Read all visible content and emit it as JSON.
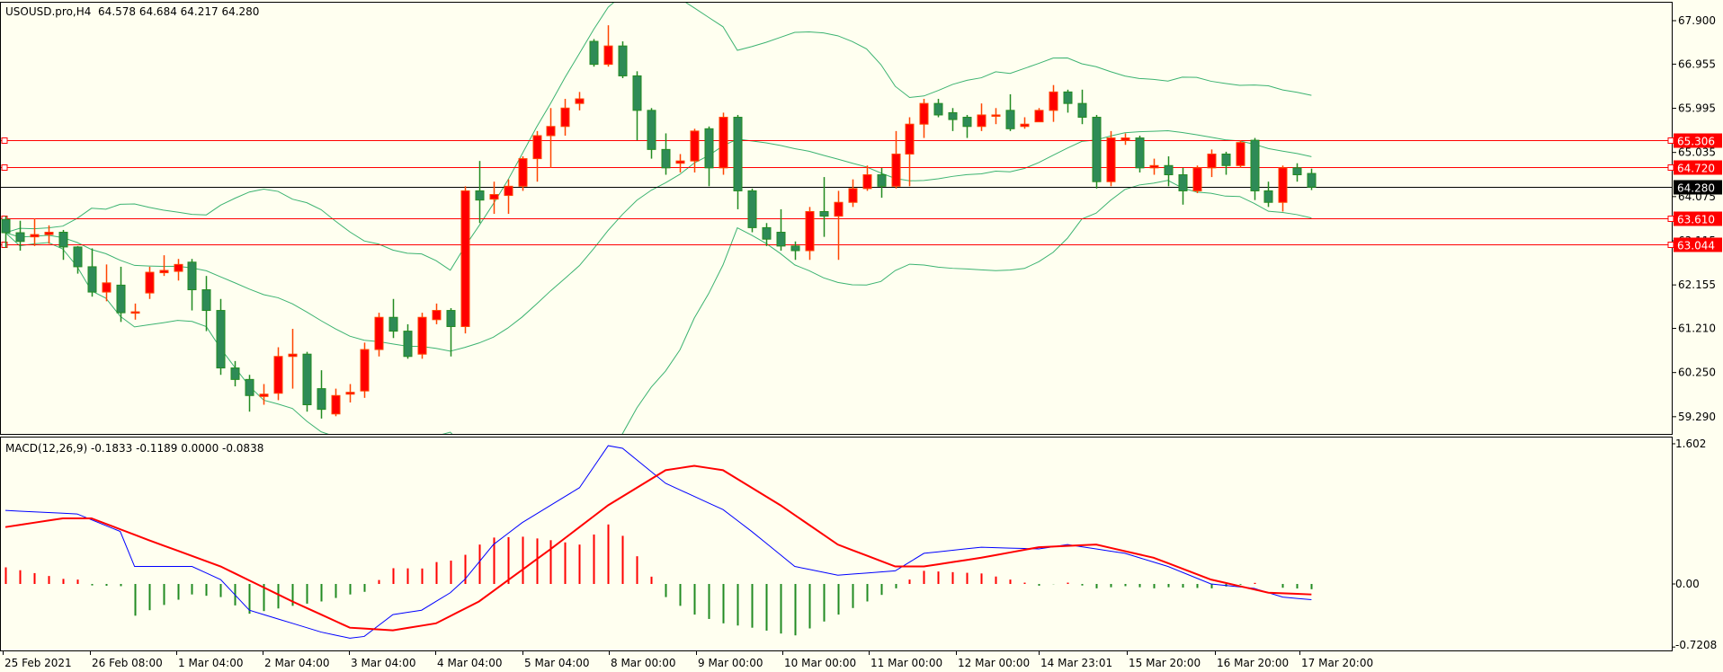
{
  "header": {
    "symbol": "USOUSD.pro,H4",
    "ohlc": "64.578 64.684 64.217 64.280"
  },
  "macd_header": "MACD(12,26,9) -0.1833 -0.1189 0.0000 -0.0838",
  "colors": {
    "background": "#fffff0",
    "bull": "#ff0000",
    "bull_outline": "#ff4500",
    "bear": "#2e8b57",
    "bear_outline": "#228b22",
    "bands": "#3cb371",
    "macd_main": "#0000ff",
    "macd_signal": "#ff0000",
    "hline": "#ff0000"
  },
  "chart_data": {
    "type": "candlestick",
    "symbol": "USOUSD.pro",
    "timeframe": "H4",
    "price_axis": {
      "ticks": [
        "67.900",
        "66.955",
        "65.995",
        "65.035",
        "64.075",
        "63.115",
        "62.155",
        "61.210",
        "60.250",
        "59.290"
      ],
      "range": [
        58.9,
        67.96
      ]
    },
    "current_price": "64.280",
    "horizontal_lines": [
      "65.306",
      "64.720",
      "63.610",
      "63.044"
    ],
    "time_labels": [
      "25 Feb 2021",
      "26 Feb 08:00",
      "1 Mar 04:00",
      "2 Mar 04:00",
      "3 Mar 04:00",
      "4 Mar 04:00",
      "5 Mar 04:00",
      "8 Mar 00:00",
      "9 Mar 00:00",
      "10 Mar 00:00",
      "11 Mar 00:00",
      "12 Mar 00:00",
      "14 Mar 23:01",
      "15 Mar 20:00",
      "16 Mar 20:00",
      "17 Mar 20:00"
    ],
    "candles_ohlc": [
      [
        63.58,
        63.65,
        62.96,
        63.29
      ],
      [
        63.29,
        63.55,
        62.9,
        63.1
      ],
      [
        63.2,
        63.6,
        63.0,
        63.25
      ],
      [
        63.25,
        63.45,
        63.05,
        63.3
      ],
      [
        63.3,
        63.35,
        62.7,
        62.98
      ],
      [
        62.98,
        63.0,
        62.4,
        62.55
      ],
      [
        62.55,
        62.95,
        61.9,
        62.0
      ],
      [
        62.0,
        62.6,
        61.8,
        62.2
      ],
      [
        62.15,
        62.55,
        61.35,
        61.55
      ],
      [
        61.57,
        61.75,
        61.4,
        61.57
      ],
      [
        61.98,
        62.55,
        61.85,
        62.43
      ],
      [
        62.42,
        62.8,
        62.35,
        62.47
      ],
      [
        62.45,
        62.72,
        62.25,
        62.6
      ],
      [
        62.65,
        62.72,
        61.6,
        62.05
      ],
      [
        62.05,
        62.35,
        61.15,
        61.6
      ],
      [
        61.6,
        61.85,
        60.2,
        60.35
      ],
      [
        60.35,
        60.5,
        59.95,
        60.1
      ],
      [
        60.1,
        60.2,
        59.4,
        59.75
      ],
      [
        59.73,
        60.0,
        59.55,
        59.78
      ],
      [
        59.8,
        60.8,
        59.65,
        60.6
      ],
      [
        60.6,
        61.2,
        59.9,
        60.65
      ],
      [
        60.65,
        60.7,
        59.4,
        59.55
      ],
      [
        59.9,
        60.3,
        59.25,
        59.45
      ],
      [
        59.35,
        59.9,
        59.3,
        59.75
      ],
      [
        59.78,
        60.0,
        59.6,
        59.82
      ],
      [
        59.85,
        60.9,
        59.7,
        60.75
      ],
      [
        60.75,
        61.55,
        60.6,
        61.45
      ],
      [
        61.45,
        61.85,
        61.0,
        61.15
      ],
      [
        61.15,
        61.3,
        60.55,
        60.6
      ],
      [
        60.65,
        61.55,
        60.55,
        61.45
      ],
      [
        61.4,
        61.75,
        61.3,
        61.6
      ],
      [
        61.6,
        61.65,
        60.6,
        61.25
      ],
      [
        61.25,
        64.3,
        61.1,
        64.2
      ],
      [
        64.2,
        64.85,
        63.5,
        64.0
      ],
      [
        64.02,
        64.4,
        63.7,
        64.12
      ],
      [
        64.1,
        64.45,
        63.7,
        64.3
      ],
      [
        64.3,
        64.95,
        64.2,
        64.9
      ],
      [
        64.9,
        65.5,
        64.4,
        65.4
      ],
      [
        65.4,
        66.0,
        64.7,
        65.6
      ],
      [
        65.6,
        66.2,
        65.4,
        66.0
      ],
      [
        66.1,
        66.35,
        65.95,
        66.2
      ],
      [
        67.45,
        67.5,
        66.9,
        66.95
      ],
      [
        66.95,
        67.8,
        66.9,
        67.35
      ],
      [
        67.35,
        67.45,
        66.65,
        66.7
      ],
      [
        66.7,
        66.8,
        65.3,
        65.95
      ],
      [
        65.95,
        66.0,
        64.9,
        65.1
      ],
      [
        65.1,
        65.45,
        64.55,
        64.7
      ],
      [
        64.8,
        65.0,
        64.6,
        64.85
      ],
      [
        64.85,
        65.55,
        64.6,
        65.5
      ],
      [
        65.55,
        65.6,
        64.3,
        64.7
      ],
      [
        64.7,
        65.9,
        64.55,
        65.8
      ],
      [
        65.8,
        65.85,
        63.8,
        64.2
      ],
      [
        64.2,
        64.25,
        63.3,
        63.4
      ],
      [
        63.4,
        63.5,
        63.0,
        63.15
      ],
      [
        63.3,
        63.8,
        62.9,
        63.0
      ],
      [
        63.0,
        63.1,
        62.7,
        62.9
      ],
      [
        62.9,
        63.85,
        62.7,
        63.75
      ],
      [
        63.75,
        64.5,
        63.2,
        63.65
      ],
      [
        63.65,
        64.2,
        62.7,
        63.95
      ],
      [
        63.95,
        64.45,
        63.85,
        64.25
      ],
      [
        64.25,
        64.75,
        64.2,
        64.55
      ],
      [
        64.55,
        64.7,
        64.05,
        64.3
      ],
      [
        64.3,
        65.5,
        64.25,
        65.0
      ],
      [
        65.0,
        65.8,
        64.3,
        65.65
      ],
      [
        65.65,
        66.2,
        65.35,
        66.1
      ],
      [
        66.1,
        66.2,
        65.8,
        65.85
      ],
      [
        65.9,
        66.0,
        65.5,
        65.75
      ],
      [
        65.8,
        65.85,
        65.35,
        65.6
      ],
      [
        65.6,
        66.1,
        65.5,
        65.85
      ],
      [
        65.83,
        66.0,
        65.65,
        65.85
      ],
      [
        65.95,
        66.3,
        65.5,
        65.55
      ],
      [
        65.6,
        65.8,
        65.55,
        65.65
      ],
      [
        65.7,
        66.0,
        65.7,
        65.95
      ],
      [
        65.95,
        66.5,
        65.7,
        66.35
      ],
      [
        66.35,
        66.4,
        65.9,
        66.1
      ],
      [
        66.1,
        66.4,
        65.65,
        65.8
      ],
      [
        65.8,
        65.85,
        64.25,
        64.4
      ],
      [
        64.4,
        65.5,
        64.3,
        65.35
      ],
      [
        65.3,
        65.45,
        65.2,
        65.35
      ],
      [
        65.35,
        65.4,
        64.6,
        64.7
      ],
      [
        64.7,
        64.9,
        64.55,
        64.75
      ],
      [
        64.75,
        64.95,
        64.3,
        64.55
      ],
      [
        64.55,
        64.7,
        63.9,
        64.2
      ],
      [
        64.2,
        64.75,
        64.15,
        64.7
      ],
      [
        64.7,
        65.1,
        64.5,
        65.0
      ],
      [
        65.0,
        65.05,
        64.55,
        64.75
      ],
      [
        64.75,
        65.3,
        64.7,
        65.25
      ],
      [
        65.3,
        65.35,
        64.0,
        64.2
      ],
      [
        64.2,
        64.4,
        63.85,
        63.95
      ],
      [
        63.95,
        64.75,
        63.75,
        64.7
      ],
      [
        64.7,
        64.8,
        64.4,
        64.55
      ],
      [
        64.578,
        64.684,
        64.217,
        64.28
      ]
    ],
    "bollinger": {
      "period": 20,
      "deviation": 2
    },
    "macd": {
      "params": "12,26,9",
      "axis_ticks": [
        "1.602",
        "0.00",
        "-0.7208"
      ],
      "range": [
        -0.7208,
        1.602
      ],
      "main_keypoints": [
        [
          0,
          0.84
        ],
        [
          5,
          0.8
        ],
        [
          8,
          0.6
        ],
        [
          9,
          0.2
        ],
        [
          13,
          0.2
        ],
        [
          15,
          0.05
        ],
        [
          17,
          -0.3
        ],
        [
          20,
          -0.45
        ],
        [
          22,
          -0.55
        ],
        [
          24,
          -0.62
        ],
        [
          25,
          -0.6
        ],
        [
          27,
          -0.35
        ],
        [
          29,
          -0.3
        ],
        [
          31,
          -0.1
        ],
        [
          32,
          0.05
        ],
        [
          34,
          0.45
        ],
        [
          36,
          0.7
        ],
        [
          40,
          1.1
        ],
        [
          42,
          1.58
        ],
        [
          43,
          1.55
        ],
        [
          46,
          1.15
        ],
        [
          48,
          1.0
        ],
        [
          50,
          0.85
        ],
        [
          52,
          0.6
        ],
        [
          55,
          0.2
        ],
        [
          58,
          0.1
        ],
        [
          62,
          0.15
        ],
        [
          64,
          0.35
        ],
        [
          68,
          0.42
        ],
        [
          72,
          0.4
        ],
        [
          74,
          0.45
        ],
        [
          76,
          0.4
        ],
        [
          78,
          0.35
        ],
        [
          81,
          0.2
        ],
        [
          84,
          0.0
        ],
        [
          87,
          -0.05
        ],
        [
          89,
          -0.15
        ],
        [
          91,
          -0.18
        ]
      ],
      "signal_keypoints": [
        [
          0,
          0.65
        ],
        [
          4,
          0.75
        ],
        [
          6,
          0.75
        ],
        [
          10,
          0.5
        ],
        [
          15,
          0.2
        ],
        [
          20,
          -0.2
        ],
        [
          24,
          -0.5
        ],
        [
          27,
          -0.53
        ],
        [
          30,
          -0.45
        ],
        [
          33,
          -0.2
        ],
        [
          38,
          0.4
        ],
        [
          42,
          0.9
        ],
        [
          46,
          1.3
        ],
        [
          48,
          1.35
        ],
        [
          50,
          1.3
        ],
        [
          54,
          0.9
        ],
        [
          58,
          0.45
        ],
        [
          62,
          0.2
        ],
        [
          64,
          0.2
        ],
        [
          68,
          0.3
        ],
        [
          72,
          0.42
        ],
        [
          76,
          0.45
        ],
        [
          80,
          0.3
        ],
        [
          84,
          0.05
        ],
        [
          88,
          -0.1
        ],
        [
          91,
          -0.12
        ]
      ]
    }
  }
}
